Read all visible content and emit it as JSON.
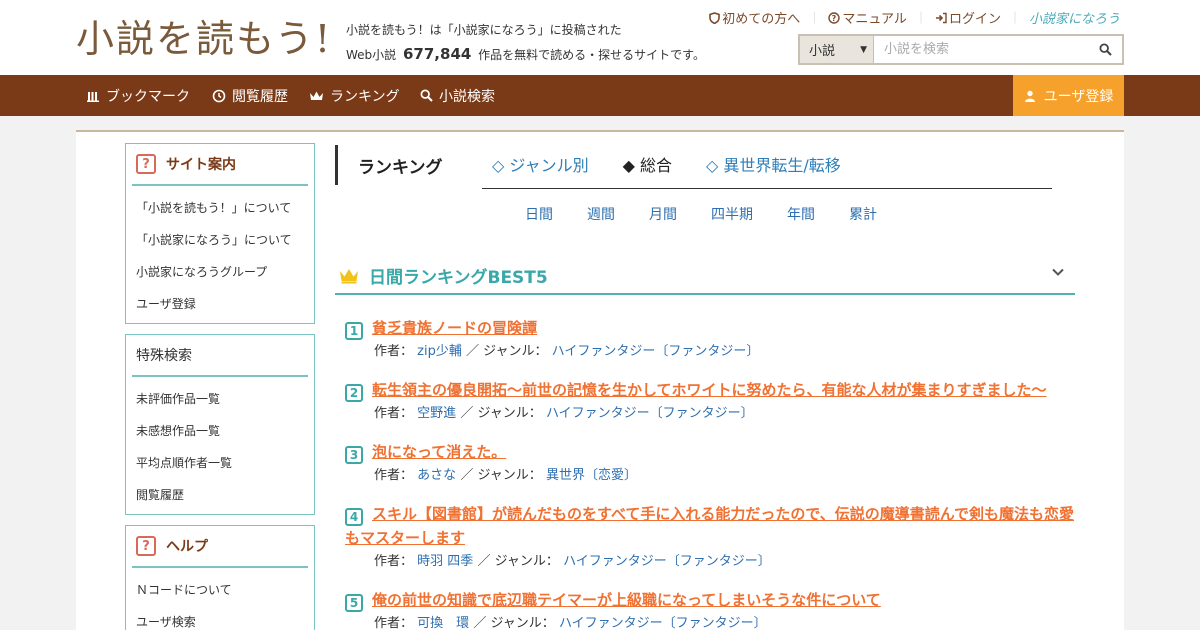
{
  "header": {
    "logo": "小説を読もう!",
    "tagline_line1": "小説を読もう！は「小説家になろう」に投稿された",
    "tagline_prefix": "Web小説",
    "work_count": "677,844",
    "tagline_suffix": "作品を無料で読める・探せるサイトです。",
    "top_links": [
      "初めての方へ",
      "マニュアル",
      "ログイン"
    ],
    "narou_logo": "小説家になろう",
    "search": {
      "category": "小説",
      "placeholder": "小説を検索"
    }
  },
  "nav": {
    "items": [
      "ブックマーク",
      "閲覧履歴",
      "ランキング",
      "小説検索"
    ],
    "register": "ユーザ登録"
  },
  "sidebar": {
    "site_info": {
      "title": "サイト案内",
      "items": [
        "「小説を読もう！」について",
        "「小説家になろう」について",
        "小説家になろうグループ",
        "ユーザ登録"
      ]
    },
    "special": {
      "title": "特殊検索",
      "items": [
        "未評価作品一覧",
        "未感想作品一覧",
        "平均点順作者一覧",
        "閲覧履歴"
      ]
    },
    "help": {
      "title": "ヘルプ",
      "items": [
        "Ｎコードについて",
        "ユーザ検索"
      ]
    }
  },
  "ranking": {
    "heading": "ランキング",
    "tabs": [
      "◇ ジャンル別",
      "◆ 総合",
      "◇ 異世界転生/転移"
    ],
    "periods": [
      "日間",
      "週間",
      "月間",
      "四半期",
      "年間",
      "累計"
    ],
    "best_title": "日間ランキングBEST5",
    "author_label": "作者：",
    "genre_label": "／ ジャンル：",
    "entries": [
      {
        "rank": "1",
        "title": "貧乏貴族ノードの冒険譚",
        "author": "zip少輔",
        "genre": "ハイファンタジー〔ファンタジー〕"
      },
      {
        "rank": "2",
        "title": "転生領主の優良開拓〜前世の記憶を生かしてホワイトに努めたら、有能な人材が集まりすぎました〜",
        "author": "空野進",
        "genre": "ハイファンタジー〔ファンタジー〕"
      },
      {
        "rank": "3",
        "title": "泡になって消えた。",
        "author": "あさな",
        "genre": "異世界〔恋愛〕"
      },
      {
        "rank": "4",
        "title": "スキル【図書館】が読んだものをすべて手に入れる能力だったので、伝説の魔導書読んで剣も魔法も恋愛もマスターします",
        "author": "時羽 四季",
        "genre": "ハイファンタジー〔ファンタジー〕"
      },
      {
        "rank": "5",
        "title": "俺の前世の知識で底辺職テイマーが上級職になってしまいそうな件について",
        "author": "可換　環",
        "genre": "ハイファンタジー〔ファンタジー〕"
      }
    ]
  },
  "colors": {
    "nav_bg": "#7b3a17",
    "register_bg": "#f5a12b",
    "accent_teal": "#3aa7a8",
    "title_orange": "#f07132",
    "link_blue": "#2e6fb0"
  }
}
